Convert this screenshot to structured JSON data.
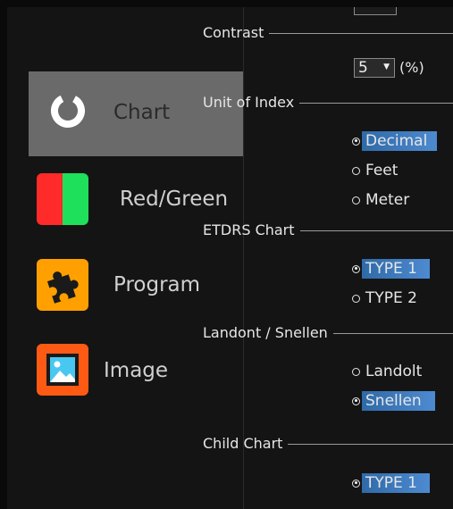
{
  "sidebar": {
    "items": [
      {
        "label": "Chart",
        "icon": "chart-ring-icon",
        "selected": true
      },
      {
        "label": "Red/Green",
        "icon": "red-green-icon",
        "selected": false
      },
      {
        "label": "Program",
        "icon": "puzzle-icon",
        "selected": false
      },
      {
        "label": "Image",
        "icon": "image-icon",
        "selected": false
      }
    ]
  },
  "settings": {
    "contrast": {
      "title": "Contrast",
      "value": "5",
      "unit": "(%)"
    },
    "unit_of_index": {
      "title": "Unit of Index",
      "options": [
        {
          "label": "Decimal",
          "checked": true
        },
        {
          "label": "Feet",
          "checked": false
        },
        {
          "label": "Meter",
          "checked": false
        }
      ]
    },
    "etdrs_chart": {
      "title": "ETDRS Chart",
      "options": [
        {
          "label": "TYPE 1",
          "checked": true
        },
        {
          "label": "TYPE 2",
          "checked": false
        }
      ]
    },
    "landolt_snellen": {
      "title": "Landont / Snellen",
      "options": [
        {
          "label": "Landolt",
          "checked": false
        },
        {
          "label": "Snellen",
          "checked": true
        }
      ]
    },
    "child_chart": {
      "title": "Child Chart",
      "options": [
        {
          "label": "TYPE 1",
          "checked": true
        }
      ]
    }
  },
  "colors": {
    "selected_bg": "#6a6a6a",
    "highlight": "#3a78c0",
    "red": "#ff2a2a",
    "green": "#1ee05a",
    "orange": "#ffa000"
  }
}
